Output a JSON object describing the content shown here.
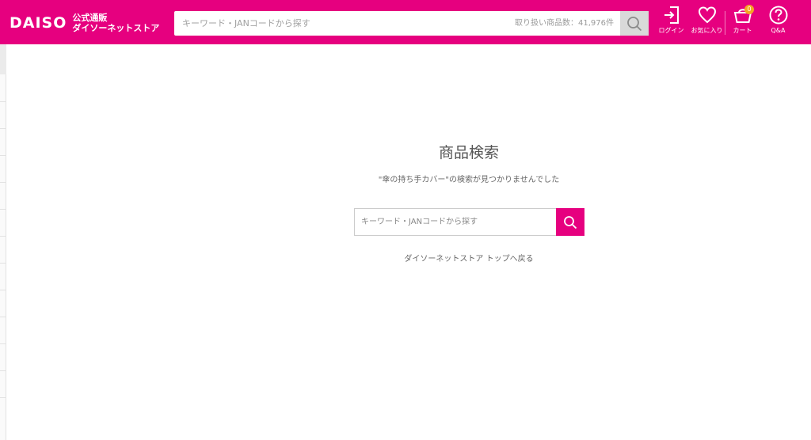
{
  "header": {
    "logo_main": "DAISO",
    "logo_line1": "公式通販",
    "logo_line2": "ダイソーネットストア",
    "search_placeholder": "キーワード・JANコードから探す",
    "product_count": "取り扱い商品数：41,976件",
    "icons": {
      "login": "ログイン",
      "favorites": "お気に入り",
      "cart": "カート",
      "cart_count": "0",
      "qa": "Q&A"
    }
  },
  "main": {
    "title": "商品検索",
    "message": "\"傘の持ち手カバー\"の検索が見つかりませんでした",
    "search_placeholder": "キーワード・JANコードから探す",
    "back_link": "ダイソーネットストア トップへ戻る"
  },
  "colors": {
    "brand": "#e6007f",
    "badge": "#f5a623"
  }
}
